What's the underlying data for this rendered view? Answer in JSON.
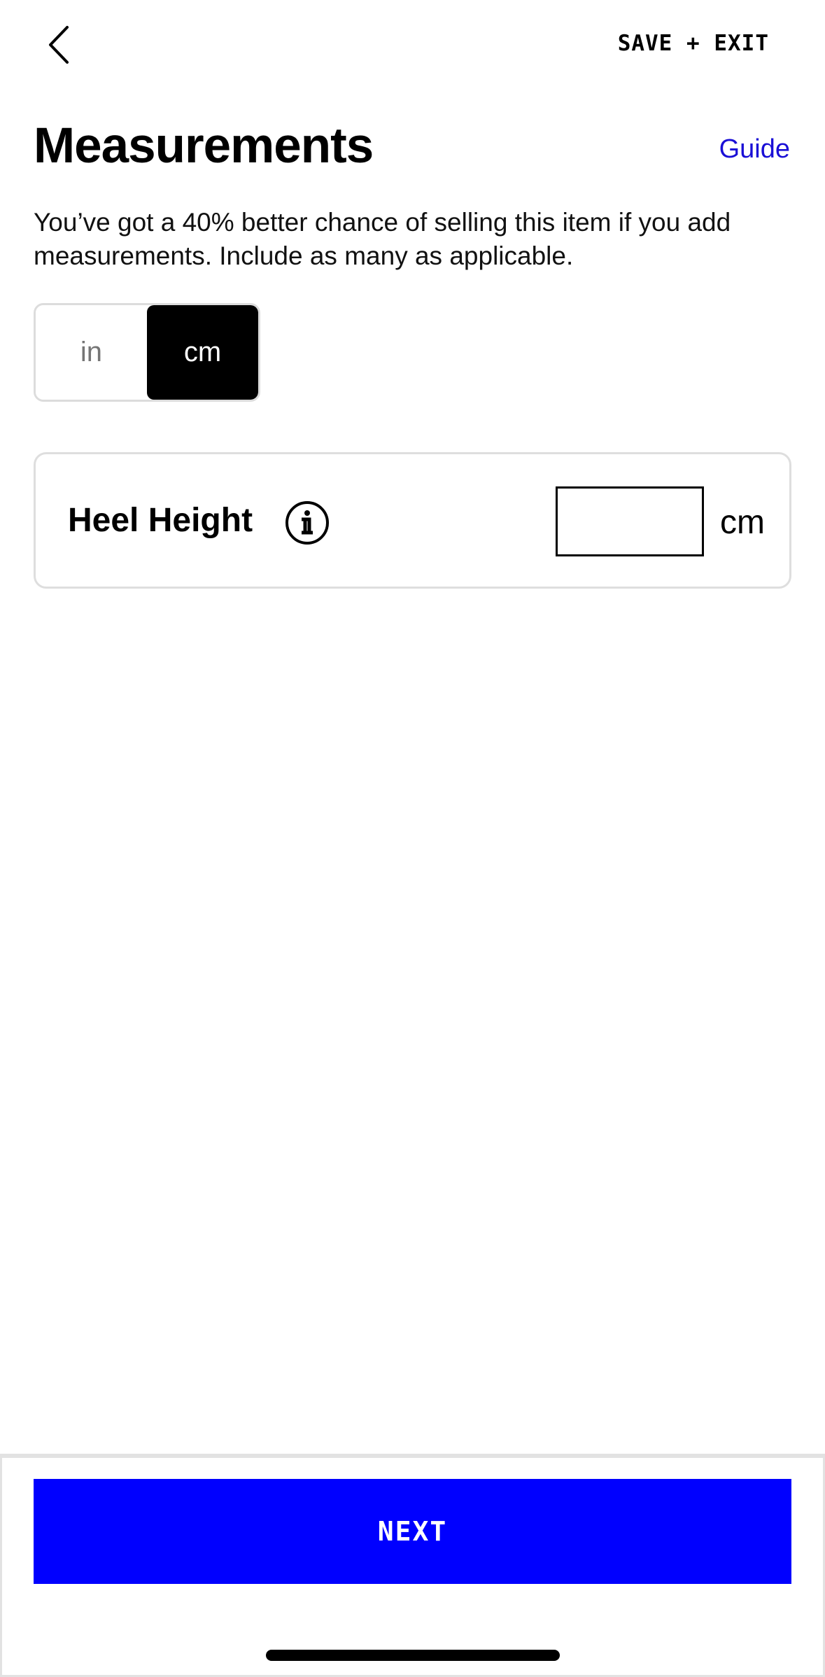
{
  "header": {
    "back_icon": "chevron-left-icon",
    "save_exit_label": "SAVE + EXIT"
  },
  "main": {
    "title": "Measurements",
    "guide_label": "Guide",
    "subtitle": "You’ve got a 40% better chance of selling this item if you add measurements. Include as many as applicable."
  },
  "unit_toggle": {
    "options": [
      {
        "label": "in",
        "selected": false
      },
      {
        "label": "cm",
        "selected": true
      }
    ]
  },
  "measurements": [
    {
      "label": "Heel Height",
      "info_icon": "info-icon",
      "value": "",
      "unit": "cm"
    }
  ],
  "footer": {
    "next_label": "NEXT"
  },
  "colors": {
    "accent": "#0000ff",
    "link": "#1a0fd6",
    "toggle_active_bg": "#000000"
  }
}
